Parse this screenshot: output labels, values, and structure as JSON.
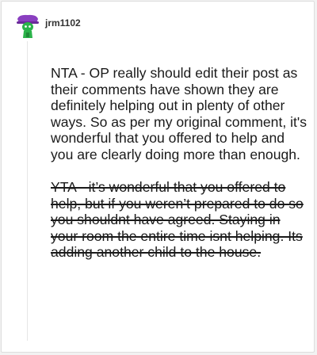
{
  "comment": {
    "username": "jrm1102",
    "avatar_icon": "snoo-avatar-icon",
    "avatar_colors": {
      "body": "#2bb34a",
      "accessory": "#8a3fc0",
      "eye": "#ffffff"
    },
    "paragraphs": {
      "edit": "NTA - OP really should edit their post as their comments have shown they are definitely helping out in plenty of other ways. So as per my original comment, it's wonderful that you offered to help and you are clearly doing more than enough.",
      "original_struck": "YTA - it’s wonderful that you offered to help, but if you weren’t prepared to do so you shouldnt have agreed. Staying in your room the entire time isnt helping. Its adding another child to the house."
    }
  }
}
